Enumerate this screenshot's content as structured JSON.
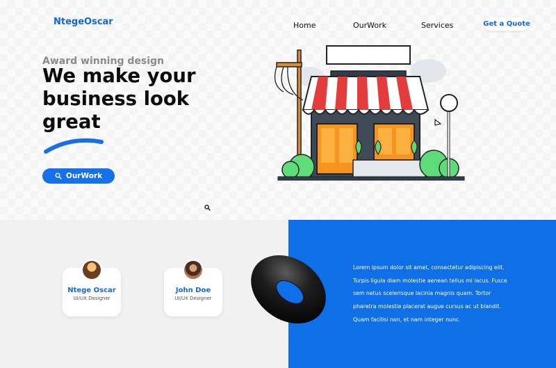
{
  "brand": {
    "name": "NtegeOscar",
    "color": "#1565e0"
  },
  "nav": {
    "items": [
      {
        "label": "Home"
      },
      {
        "label": "OurWork"
      },
      {
        "label": "Services"
      }
    ],
    "cta_label": "Get a Quote"
  },
  "hero": {
    "eyebrow": "Award winning design",
    "headline_line1": "We make your",
    "headline_line2": "business look",
    "headline_line3": "great",
    "button_label": "OurWork",
    "button_icon": "search-icon",
    "accent": "#1670e8"
  },
  "team": {
    "members": [
      {
        "name": "Ntege Oscar",
        "role": "UI/UX Designer"
      },
      {
        "name": "John Doe",
        "role": "UI/UX Designer"
      }
    ]
  },
  "info": {
    "background": "#0f6fe6",
    "lines": [
      "Lorem ipsum dolor sit amet, consectetur adipiscing elit.",
      "Turpis ligula diam molestie aenean tellus mi lacus. Fusce",
      "sem netus scelerisque lacinia magnis quam. Tortor",
      "pharetra molestie placerat augue cursus ac ut blandit.",
      "Quam facilisi non, et nam integer nunc."
    ]
  }
}
